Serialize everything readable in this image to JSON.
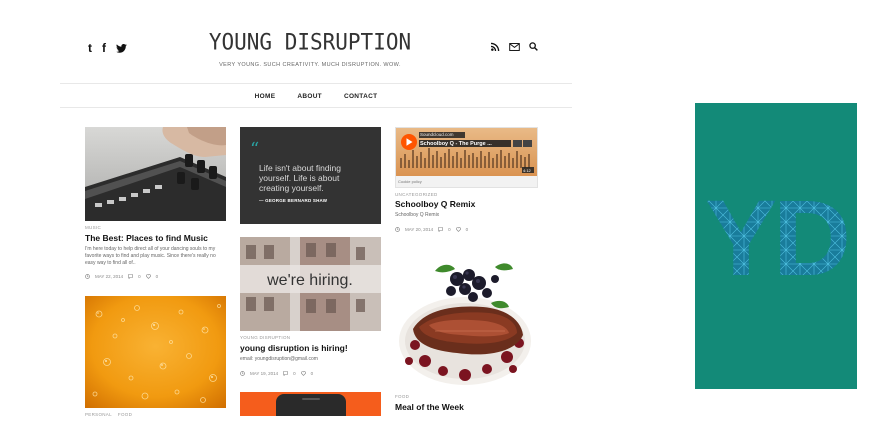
{
  "header": {
    "title": "YOUNG DISRUPTION",
    "tagline": "VERY YOUNG. SUCH CREATIVITY. MUCH DISRUPTION. WOW."
  },
  "social": {
    "tumblr": "t",
    "facebook": "f"
  },
  "nav": {
    "items": [
      "HOME",
      "ABOUT",
      "CONTACT"
    ]
  },
  "posts": {
    "music": {
      "category": "MUSIC",
      "title": "The Best: Places to find Music",
      "excerpt": "I'm here today to help direct all of your dancing souls to my favorite ways to find and play music. Since there's really no easy way to find all of..",
      "date": "MAY 22, 2014",
      "comments": "0",
      "likes": "0"
    },
    "beer": {
      "category": "PERSONAL",
      "category2": "FOOD"
    },
    "quote": {
      "mark": "“",
      "text": "Life isn't about finding yourself. Life is about creating yourself.",
      "author": "— GEORGE BERNARD SHAW"
    },
    "hiring": {
      "image_text": "we're hiring.",
      "category": "YOUNG DISRUPTION",
      "title": "young disruption is hiring!",
      "excerpt": "email: youngdisruption@gmail.com",
      "date": "MAY 19, 2014",
      "comments": "0",
      "likes": "0"
    },
    "schoolboy": {
      "embed_brand": "Soundcloud.com",
      "embed_user": "Theinsiderschi",
      "embed_title": "Schoolboy Q - The Purge ...",
      "embed_time": "4:12",
      "cookie": "Cookie policy",
      "category": "UNCATEGORIZED",
      "title": "Schoolboy Q Remix",
      "excerpt": "Schoolboy Q Remix",
      "date": "MAY 20, 2014",
      "comments": "0",
      "likes": "0"
    },
    "meal": {
      "category": "FOOD",
      "title": "Meal of the Week"
    }
  },
  "sidebar": {
    "logo_letters": "YD"
  },
  "colors": {
    "teal": "#138a78",
    "soundcloud_orange": "#ff5500",
    "quote_bg": "#333333"
  }
}
